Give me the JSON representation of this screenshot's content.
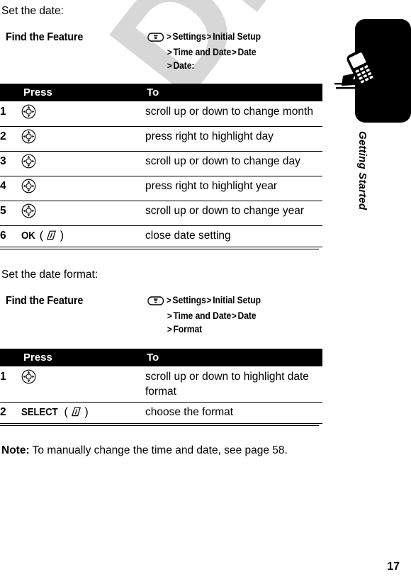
{
  "page": {
    "number": "17",
    "watermark": "DRAFT"
  },
  "chapter": {
    "title": "Getting Started",
    "icon": "running-phone-icon"
  },
  "sections": [
    {
      "heading": "Set the date:",
      "find_the_feature": {
        "label": "Find the Feature",
        "menu_icon": "menu-key-icon",
        "path_lines": [
          {
            "leading_icon": true,
            "items": [
              "Settings",
              "Initial Setup"
            ]
          },
          {
            "leading_icon": false,
            "items": [
              "Time and Date",
              "Date"
            ]
          },
          {
            "leading_icon": false,
            "items": [
              "Date:"
            ]
          }
        ]
      },
      "table": {
        "headers": {
          "num": "",
          "press": "Press",
          "to": "To"
        },
        "rows": [
          {
            "num": "1",
            "press_icon": "navigation-key-icon",
            "press_label": "",
            "softkey_icon": "",
            "to": "scroll up or down to change month"
          },
          {
            "num": "2",
            "press_icon": "navigation-key-icon",
            "press_label": "",
            "softkey_icon": "",
            "to": "press right to highlight day"
          },
          {
            "num": "3",
            "press_icon": "navigation-key-icon",
            "press_label": "",
            "softkey_icon": "",
            "to": "scroll up or down to change day"
          },
          {
            "num": "4",
            "press_icon": "navigation-key-icon",
            "press_label": "",
            "softkey_icon": "",
            "to": "press right to highlight year"
          },
          {
            "num": "5",
            "press_icon": "navigation-key-icon",
            "press_label": "",
            "softkey_icon": "",
            "to": "scroll up or down to change year"
          },
          {
            "num": "6",
            "press_icon": "",
            "press_label": "OK",
            "softkey_icon": "soft-key-icon",
            "to": "close date setting"
          }
        ]
      }
    },
    {
      "heading": "Set the date format:",
      "find_the_feature": {
        "label": "Find the Feature",
        "menu_icon": "menu-key-icon",
        "path_lines": [
          {
            "leading_icon": true,
            "items": [
              "Settings",
              "Initial Setup"
            ]
          },
          {
            "leading_icon": false,
            "items": [
              "Time and Date",
              "Date"
            ]
          },
          {
            "leading_icon": false,
            "items": [
              "Format"
            ]
          }
        ]
      },
      "table": {
        "headers": {
          "num": "",
          "press": "Press",
          "to": "To"
        },
        "rows": [
          {
            "num": "1",
            "press_icon": "navigation-key-icon",
            "press_label": "",
            "softkey_icon": "",
            "to": "scroll up or down to highlight date format"
          },
          {
            "num": "2",
            "press_icon": "",
            "press_label": "SELECT",
            "softkey_icon": "soft-key-icon",
            "to": "choose the format"
          }
        ]
      }
    }
  ],
  "note": {
    "prefix": "Note:",
    "text": "To manually change the time and date, see page 58."
  },
  "separators": {
    "gt": ">"
  },
  "colors": {
    "text": "#000000",
    "header_bar": "#000000",
    "header_text": "#ffffff",
    "watermark": "#d7d7d7",
    "page_background": "#ffffff"
  }
}
